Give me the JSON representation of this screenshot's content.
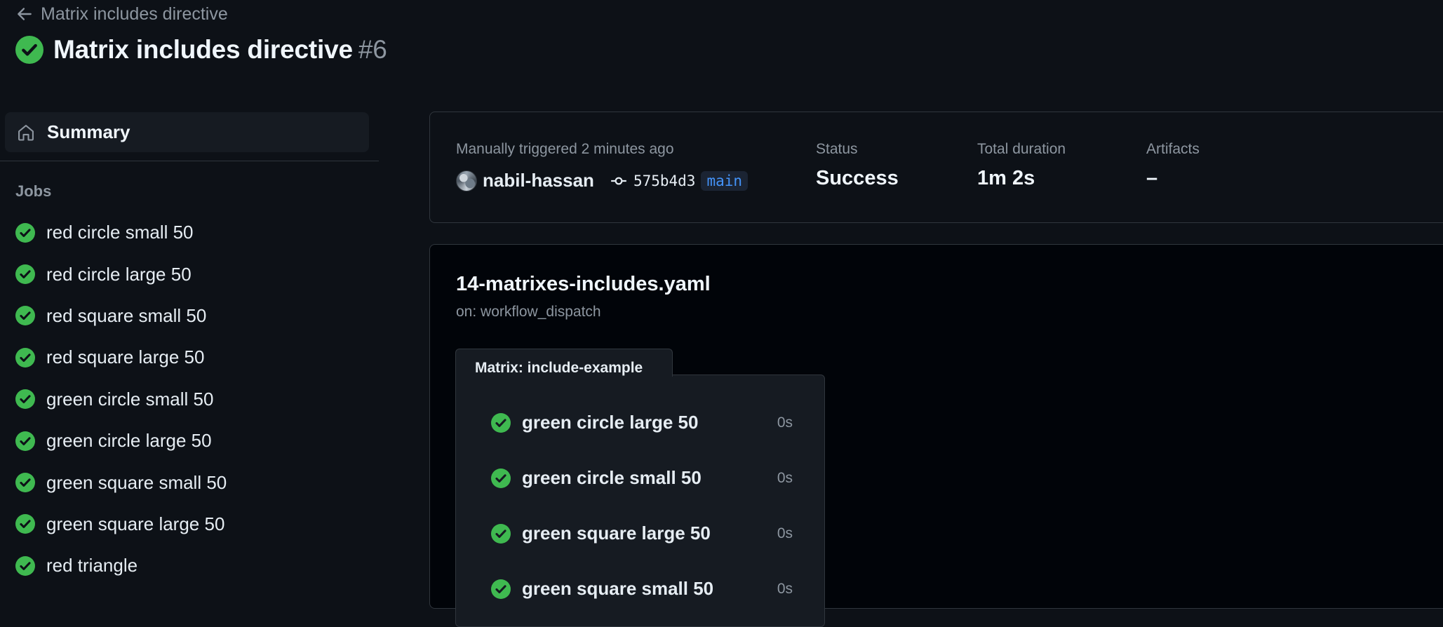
{
  "header": {
    "back_label": "Matrix includes directive",
    "title": "Matrix includes directive",
    "run_number": "#6"
  },
  "sidebar": {
    "summary_label": "Summary",
    "jobs_heading": "Jobs",
    "jobs": [
      {
        "label": "red circle small 50",
        "status": "success"
      },
      {
        "label": "red circle large 50",
        "status": "success"
      },
      {
        "label": "red square small 50",
        "status": "success"
      },
      {
        "label": "red square large 50",
        "status": "success"
      },
      {
        "label": "green circle small 50",
        "status": "success"
      },
      {
        "label": "green circle large 50",
        "status": "success"
      },
      {
        "label": "green square small 50",
        "status": "success"
      },
      {
        "label": "green square large 50",
        "status": "success"
      },
      {
        "label": "red triangle",
        "status": "success"
      }
    ]
  },
  "summary": {
    "trigger_text": "Manually triggered 2 minutes ago",
    "actor": "nabil-hassan",
    "commit_sha": "575b4d3",
    "branch": "main",
    "status_label": "Status",
    "status_value": "Success",
    "duration_label": "Total duration",
    "duration_value": "1m 2s",
    "artifacts_label": "Artifacts",
    "artifacts_value": "–"
  },
  "workflow": {
    "file": "14-matrixes-includes.yaml",
    "trigger": "on: workflow_dispatch",
    "matrix_label": "Matrix: include-example",
    "matrix_jobs": [
      {
        "label": "green circle large 50",
        "duration": "0s"
      },
      {
        "label": "green circle small 50",
        "duration": "0s"
      },
      {
        "label": "green square large 50",
        "duration": "0s"
      },
      {
        "label": "green square small 50",
        "duration": "0s"
      }
    ]
  },
  "colors": {
    "background": "#0d1117",
    "success": "#3fb950",
    "accent": "#4493f8",
    "muted_text": "#8d96a0"
  }
}
